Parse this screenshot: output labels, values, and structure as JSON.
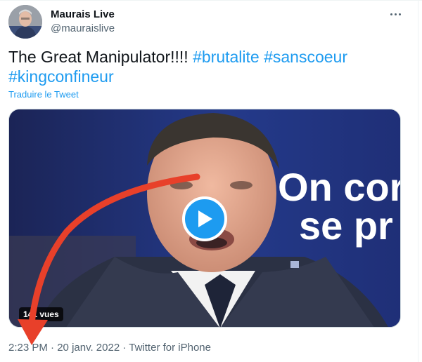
{
  "author": {
    "display_name": "Maurais Live",
    "handle": "@mauraislive",
    "avatar_icon": "user-avatar"
  },
  "tweet": {
    "text_plain": "The Great Manipulator!!!!",
    "hashtags": [
      "#brutalite",
      "#sanscoeur",
      "#kingconfineur"
    ],
    "translate_label": "Traduire le Tweet"
  },
  "media": {
    "type": "video",
    "view_count": "141 vues",
    "overlay_text": "On con se pr",
    "overlay_line1": "On cor",
    "overlay_line2": "se pr",
    "play_icon": "play-icon"
  },
  "meta": {
    "time": "2:23 PM",
    "separator": "·",
    "date": "20 janv. 2022",
    "source": "Twitter for iPhone"
  },
  "colors": {
    "link": "#1d9bf0",
    "secondary_text": "#536471",
    "annotation_arrow": "#e8402a"
  }
}
